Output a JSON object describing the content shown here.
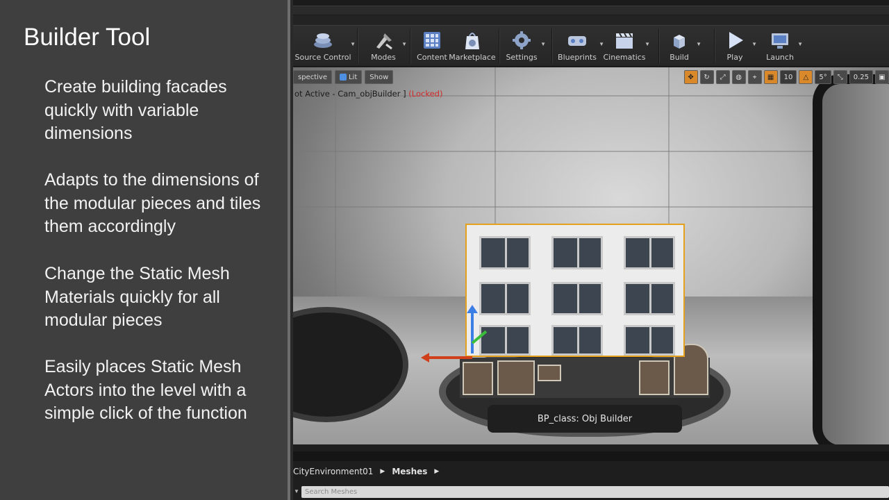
{
  "slide": {
    "title": "Builder Tool",
    "bullets": [
      "Create building facades quickly with variable dimensions",
      "Adapts to the dimensions of the modular pieces and tiles them accordingly",
      "Change the Static Mesh Materials quickly for all modular pieces",
      "Easily places Static Mesh Actors into the level with a simple click of the function"
    ]
  },
  "toolbar": {
    "buttons": [
      {
        "label": "Source Control",
        "icon": "source-control-icon"
      },
      {
        "label": "Modes",
        "icon": "modes-icon"
      },
      {
        "label": "Content",
        "icon": "content-icon"
      },
      {
        "label": "Marketplace",
        "icon": "marketplace-icon"
      },
      {
        "label": "Settings",
        "icon": "settings-icon"
      },
      {
        "label": "Blueprints",
        "icon": "blueprints-icon"
      },
      {
        "label": "Cinematics",
        "icon": "cinematics-icon"
      },
      {
        "label": "Build",
        "icon": "build-icon"
      },
      {
        "label": "Play",
        "icon": "play-icon"
      },
      {
        "label": "Launch",
        "icon": "launch-icon"
      }
    ]
  },
  "viewport": {
    "view_mode": "spective",
    "lit_label": "Lit",
    "show_label": "Show",
    "status": "ot Active - Cam_objBuilder ]",
    "locked": "(Locked)",
    "grid_snap": "10",
    "rotation_snap": "5°",
    "scale_snap": "0.25",
    "actor_label": "BP_class:  Obj Builder"
  },
  "content_browser": {
    "breadcrumbs": [
      "CityEnvironment01",
      "Meshes"
    ],
    "search_placeholder": "Search Meshes"
  },
  "colors": {
    "panel_bg": "#3f3f3f",
    "selection_outline": "#e4a11b",
    "locked_text": "#d22b2b"
  }
}
